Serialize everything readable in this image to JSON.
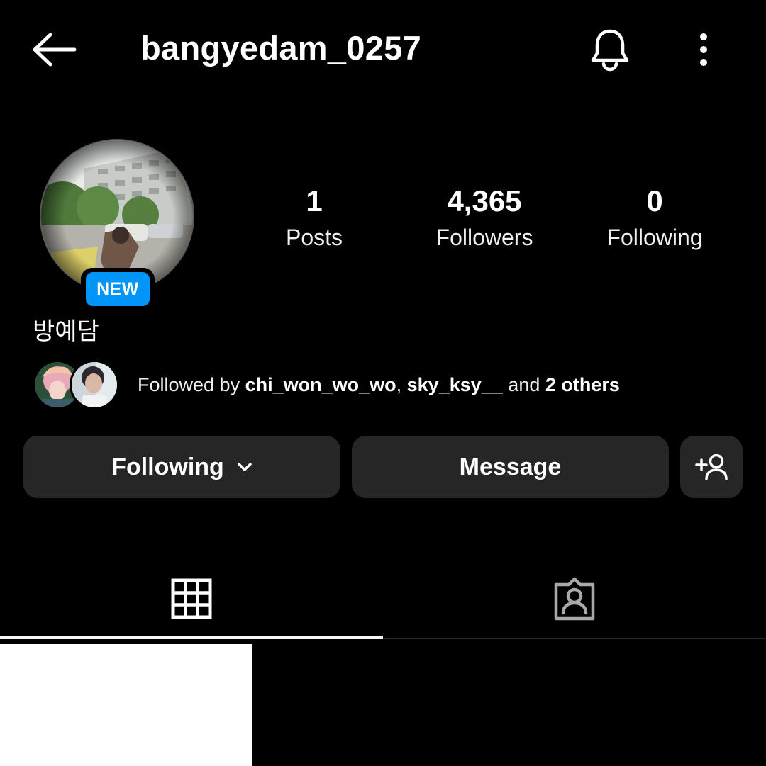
{
  "header": {
    "username": "bangyedam_0257",
    "back_icon": "arrow-left-icon",
    "bell_icon": "bell-icon",
    "more_icon": "more-vertical-icon"
  },
  "profile": {
    "badge": "NEW",
    "display_name": "방예담",
    "stats": [
      {
        "value": "1",
        "label": "Posts"
      },
      {
        "value": "4,365",
        "label": "Followers"
      },
      {
        "value": "0",
        "label": "Following"
      }
    ]
  },
  "mutual": {
    "prefix": "Followed by ",
    "user1": "chi_won_wo_wo",
    "sep": ", ",
    "user2": "sky_ksy__",
    "mid": " and ",
    "others": "2 others"
  },
  "actions": {
    "following_label": "Following",
    "message_label": "Message",
    "add_user_icon": "add-user-icon"
  },
  "tabs": {
    "grid_icon": "grid-icon",
    "tagged_icon": "tagged-icon",
    "active": "grid"
  },
  "colors": {
    "background": "#000000",
    "button": "#262626",
    "badge": "#0095f6",
    "text": "#ffffff"
  }
}
